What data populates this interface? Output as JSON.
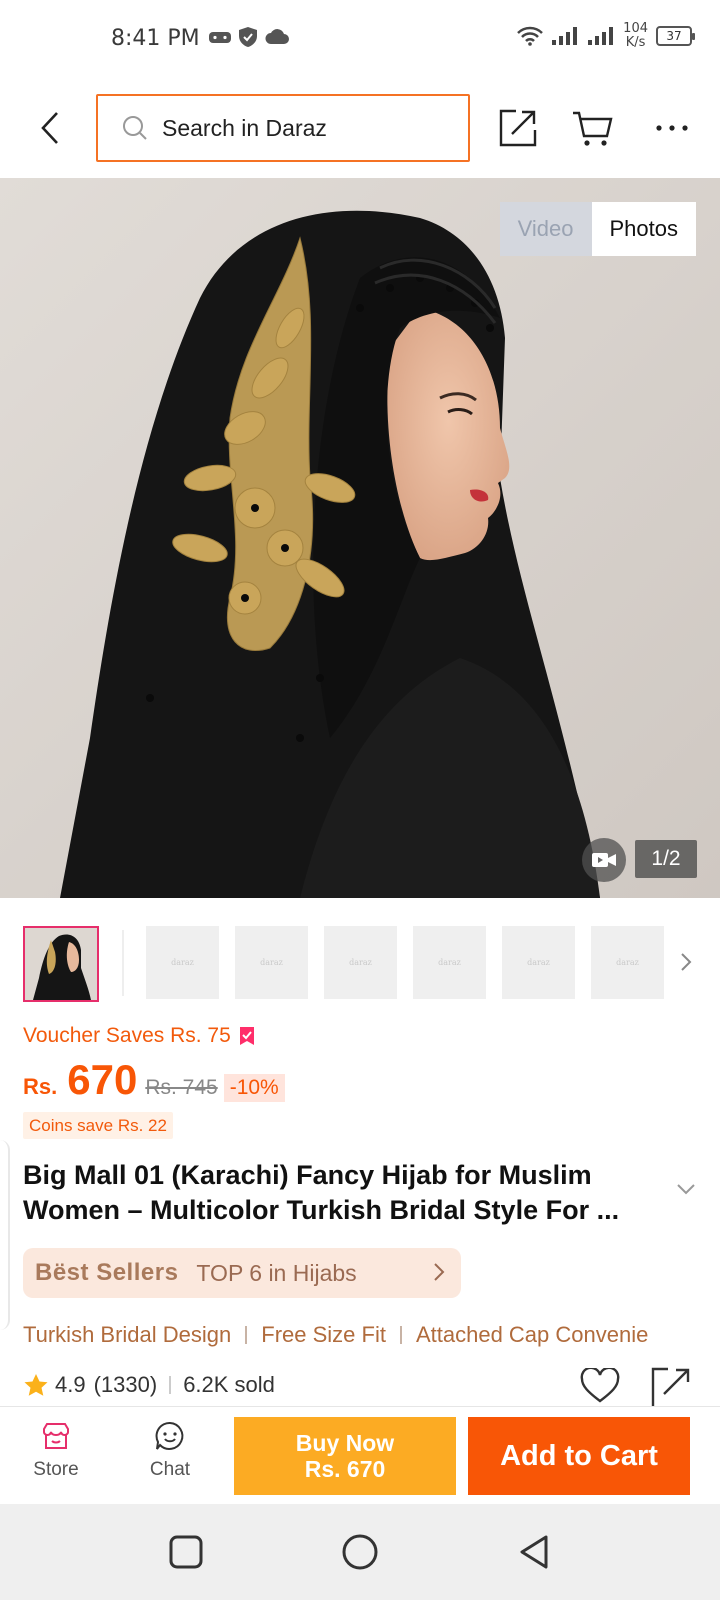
{
  "status_bar": {
    "time": "8:41 PM",
    "net_speed_value": "104",
    "net_speed_unit": "K/s",
    "battery": "37"
  },
  "header": {
    "search_placeholder": "Search in Daraz"
  },
  "gallery": {
    "tab_video": "Video",
    "tab_photos": "Photos",
    "page_indicator": "1/2",
    "thumbnail_placeholder": "daraz"
  },
  "pricing": {
    "voucher_text": "Voucher Saves Rs. 75",
    "currency": "Rs.",
    "price": "670",
    "original_price": "Rs. 745",
    "discount": "-10%",
    "coins_text": "Coins save Rs. 22"
  },
  "product": {
    "title": "Big Mall 01 (Karachi) Fancy Hijab for Muslim Women – Multicolor Turkish Bridal Style For ..."
  },
  "best_sellers": {
    "logo": "Bëst Sellers",
    "rank_text": "TOP 6 in Hijabs"
  },
  "features": [
    "Turkish Bridal Design",
    "Free Size Fit",
    "Attached Cap Convenie"
  ],
  "rating": {
    "score": "4.9",
    "count": "(1330)",
    "sold": "6.2K sold"
  },
  "action_bar": {
    "store_label": "Store",
    "chat_label": "Chat",
    "buy_now_label": "Buy Now",
    "buy_now_price": "Rs. 670",
    "add_to_cart_label": "Add to Cart"
  },
  "colors": {
    "accent_orange": "#f85606",
    "buy_now_yellow": "#fcab23",
    "voucher_pink": "#ff2e6a"
  }
}
